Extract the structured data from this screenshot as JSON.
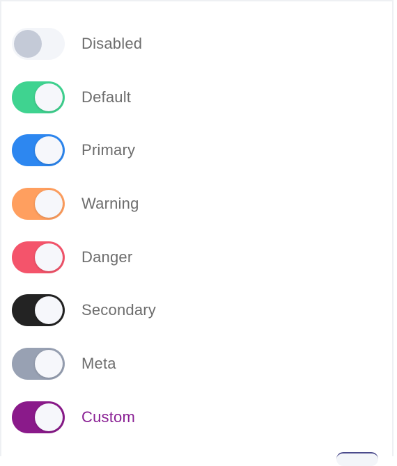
{
  "toggles": [
    {
      "label": "Disabled",
      "state": "off",
      "color": "#c4cad7",
      "track": "#f3f5f9"
    },
    {
      "label": "Default",
      "state": "on",
      "color": "#3fd390"
    },
    {
      "label": "Primary",
      "state": "on",
      "color": "#2d87f0"
    },
    {
      "label": "Warning",
      "state": "on",
      "color": "#ff9f5f"
    },
    {
      "label": "Danger",
      "state": "on",
      "color": "#f4546b"
    },
    {
      "label": "Secondary",
      "state": "on",
      "color": "#232323"
    },
    {
      "label": "Meta",
      "state": "on",
      "color": "#98a1b3"
    },
    {
      "label": "Custom",
      "state": "on",
      "color": "#8a1a8a",
      "label_color": "#8a2094"
    }
  ]
}
